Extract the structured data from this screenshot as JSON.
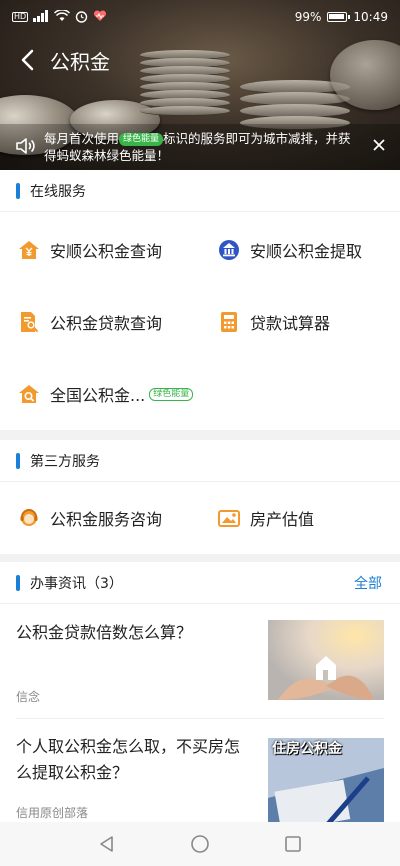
{
  "status_bar": {
    "left_icons": [
      "hd-icon",
      "signal-icon",
      "wifi-icon",
      "alarm-icon",
      "health-icon"
    ],
    "hd_text": "HD",
    "battery_percent": "99%",
    "battery_level": 0.99,
    "time": "10:49"
  },
  "navbar": {
    "title": "公积金"
  },
  "notice": {
    "text_before": "每月首次使用",
    "badge": "绿色能量",
    "text_after": "标识的服务即可为城市减排，并获得蚂蚁森林绿色能量！"
  },
  "online_services": {
    "title": "在线服务",
    "items": [
      {
        "label": "安顺公积金查询",
        "icon": "house-yen-icon",
        "color": "#f29a2e"
      },
      {
        "label": "安顺公积金提取",
        "icon": "bank-emblem-icon",
        "color": "#2f55c4"
      },
      {
        "label": "公积金贷款查询",
        "icon": "document-search-icon",
        "color": "#f29a2e"
      },
      {
        "label": "贷款试算器",
        "icon": "calculator-icon",
        "color": "#f29a2e"
      },
      {
        "label": "全国公积金...",
        "icon": "house-search-icon",
        "color": "#f29a2e",
        "badge": "绿色能量"
      }
    ]
  },
  "third_party_services": {
    "title": "第三方服务",
    "items": [
      {
        "label": "公积金服务咨询",
        "icon": "agent-icon",
        "color": "#f29a2e"
      },
      {
        "label": "房产估值",
        "icon": "house-photo-icon",
        "color": "#f29a2e"
      }
    ]
  },
  "news": {
    "title": "办事资讯（3）",
    "more": "全部",
    "items": [
      {
        "title": "公积金贷款倍数怎么算？",
        "source": "信念",
        "thumb": "hands-house-image"
      },
      {
        "title": "个人取公积金怎么取，不买房怎么提取公积金？",
        "source": "信用原创部落",
        "thumb": "housing-fund-image",
        "thumb_caption": "住房公积金"
      }
    ]
  },
  "colors": {
    "accent": "#1a7fd6",
    "icon_orange": "#f29a2e",
    "eco_green": "#38b449"
  }
}
